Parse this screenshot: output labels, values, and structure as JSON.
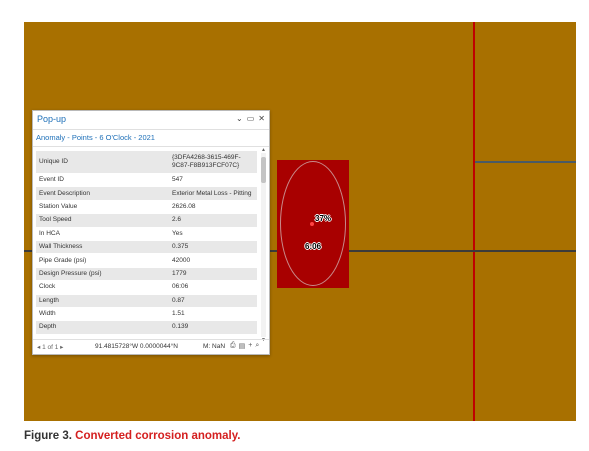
{
  "popup": {
    "title": "Pop-up",
    "controls": {
      "collapse": "⌄",
      "restore": "▭",
      "close": "✕"
    },
    "layer_title": "Anomaly - Points - 6 O'Clock - 2021",
    "rows": [
      {
        "key": "Unique ID",
        "value": "{3DFA4268-3615-469F-9C87-F8B913FCF07C}"
      },
      {
        "key": "Event ID",
        "value": "547"
      },
      {
        "key": "Event Description",
        "value": "Exterior Metal Loss - Pitting"
      },
      {
        "key": "Station Value",
        "value": "2626.08"
      },
      {
        "key": "Tool Speed",
        "value": "2.6"
      },
      {
        "key": "In HCA",
        "value": "Yes"
      },
      {
        "key": "Wall Thickness",
        "value": "0.375"
      },
      {
        "key": "Pipe Grade (psi)",
        "value": "42000"
      },
      {
        "key": "Design Pressure (psi)",
        "value": "1779"
      },
      {
        "key": "Clock",
        "value": "06:06"
      },
      {
        "key": "Length",
        "value": "0.87"
      },
      {
        "key": "Width",
        "value": "1.51"
      },
      {
        "key": "Depth",
        "value": "0.139"
      },
      {
        "key": "Depth %",
        "value": "37"
      }
    ],
    "footer": {
      "pager": "◂ 1 of 1 ▸",
      "coordinates": "91.4815728°W 0.0000044°N",
      "m_value": "M: NaN",
      "icons": [
        "print-icon",
        "export-icon",
        "add-icon",
        "zoom-icon"
      ]
    }
  },
  "map": {
    "labels": {
      "depth_pct": "37%",
      "clock": "6:06"
    },
    "colors": {
      "background": "#a87000",
      "anomaly": "#a80000",
      "grid_red": "#c00000"
    }
  },
  "caption": {
    "prefix": "Figure 3.",
    "text": "Converted corrosion anomaly."
  }
}
